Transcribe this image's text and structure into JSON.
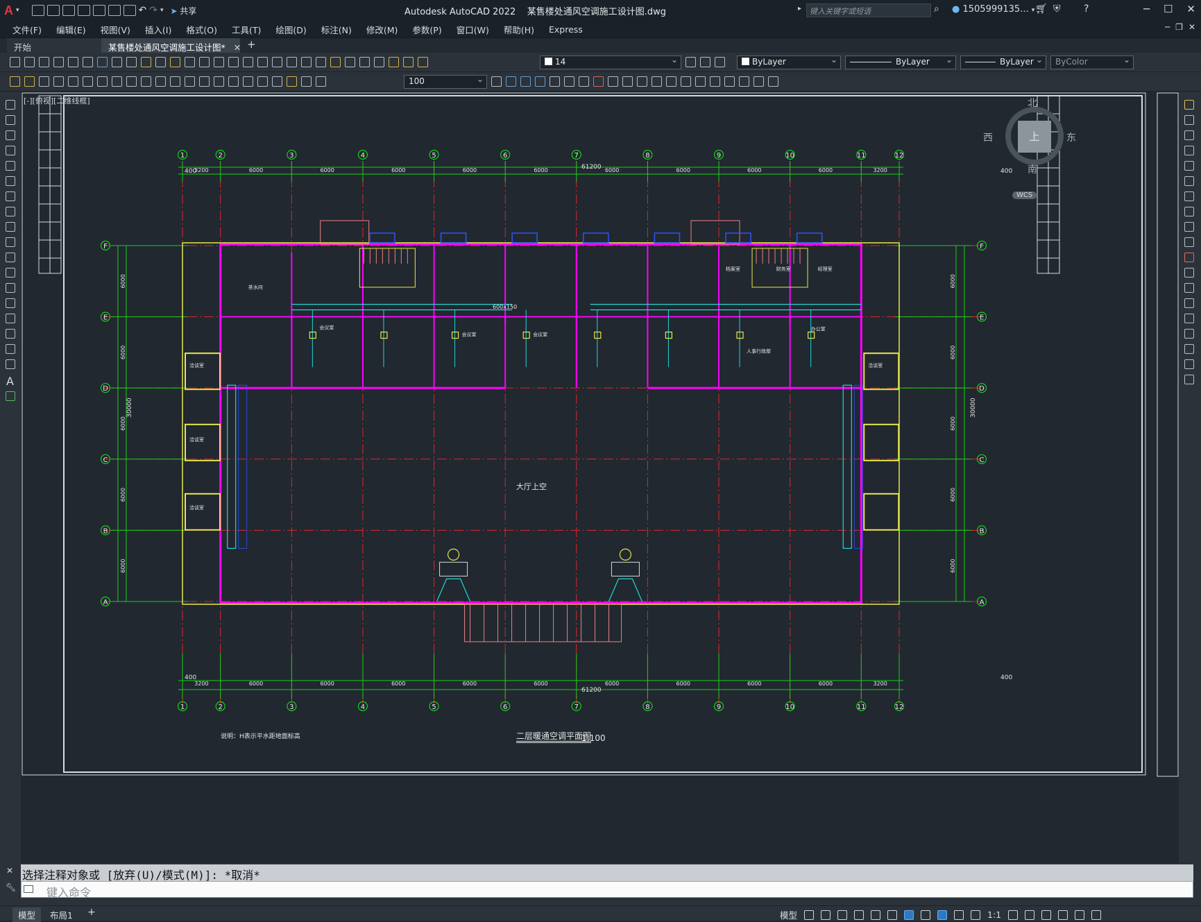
{
  "app": {
    "name": "Autodesk AutoCAD 2022",
    "file": "某售楼处通风空调施工设计图.dwg"
  },
  "quick_access": {
    "share": "共享"
  },
  "search": {
    "placeholder": "键入关键字或短语"
  },
  "user": {
    "name": "1505999135..."
  },
  "menu": [
    "文件(F)",
    "编辑(E)",
    "视图(V)",
    "插入(I)",
    "格式(O)",
    "工具(T)",
    "绘图(D)",
    "标注(N)",
    "修改(M)",
    "参数(P)",
    "窗口(W)",
    "帮助(H)",
    "Express"
  ],
  "tabs": {
    "start": "开始",
    "active": "某售楼处通风空调施工设计图*"
  },
  "properties": {
    "layer": "14",
    "color": "ByLayer",
    "linetype": "ByLayer",
    "lineweight": "ByLayer",
    "plotstyle": "ByColor",
    "scale_value": "100"
  },
  "viewport": {
    "label": "[-][俯视][二维线框]"
  },
  "viewcube": {
    "north": "北",
    "south": "南",
    "east": "东",
    "west": "西",
    "top": "上",
    "wcs": "WCS"
  },
  "drawing": {
    "cols": [
      "1",
      "2",
      "3",
      "4",
      "5",
      "6",
      "7",
      "8",
      "9",
      "10",
      "11",
      "12"
    ],
    "rows": [
      "F",
      "E",
      "D",
      "C",
      "B",
      "A"
    ],
    "col_spacing": [
      "3200",
      "6000",
      "6000",
      "6000",
      "6000",
      "6000",
      "6000",
      "6000",
      "6000",
      "6000",
      "3200"
    ],
    "total_width": "61200",
    "edge_offset": "400",
    "row_spacing": [
      "6000",
      "6000",
      "6000",
      "6000",
      "6000"
    ],
    "total_height": "30000",
    "plan_title": "二层暖通空调平面图",
    "plan_scale": "1:100",
    "note": "说明：H表示平水距地面标高",
    "hall_label": "大厅上空",
    "rooms": [
      "会议室",
      "会议室",
      "会议室",
      "茶水间",
      "洽谈室",
      "洽谈室",
      "洽谈室",
      "洽谈室",
      "办公室",
      "人事行政部",
      "经理室",
      "财务室",
      "档案室",
      "大厅上空"
    ],
    "duct_label": "600x150"
  },
  "command": {
    "history": "选择注释对象或 [放弃(U)/模式(M)]: *取消*",
    "placeholder": "键入命令"
  },
  "layout_tabs": {
    "model": "模型",
    "layout1": "布局1"
  },
  "status": {
    "model": "模型",
    "scale": "1:1"
  }
}
